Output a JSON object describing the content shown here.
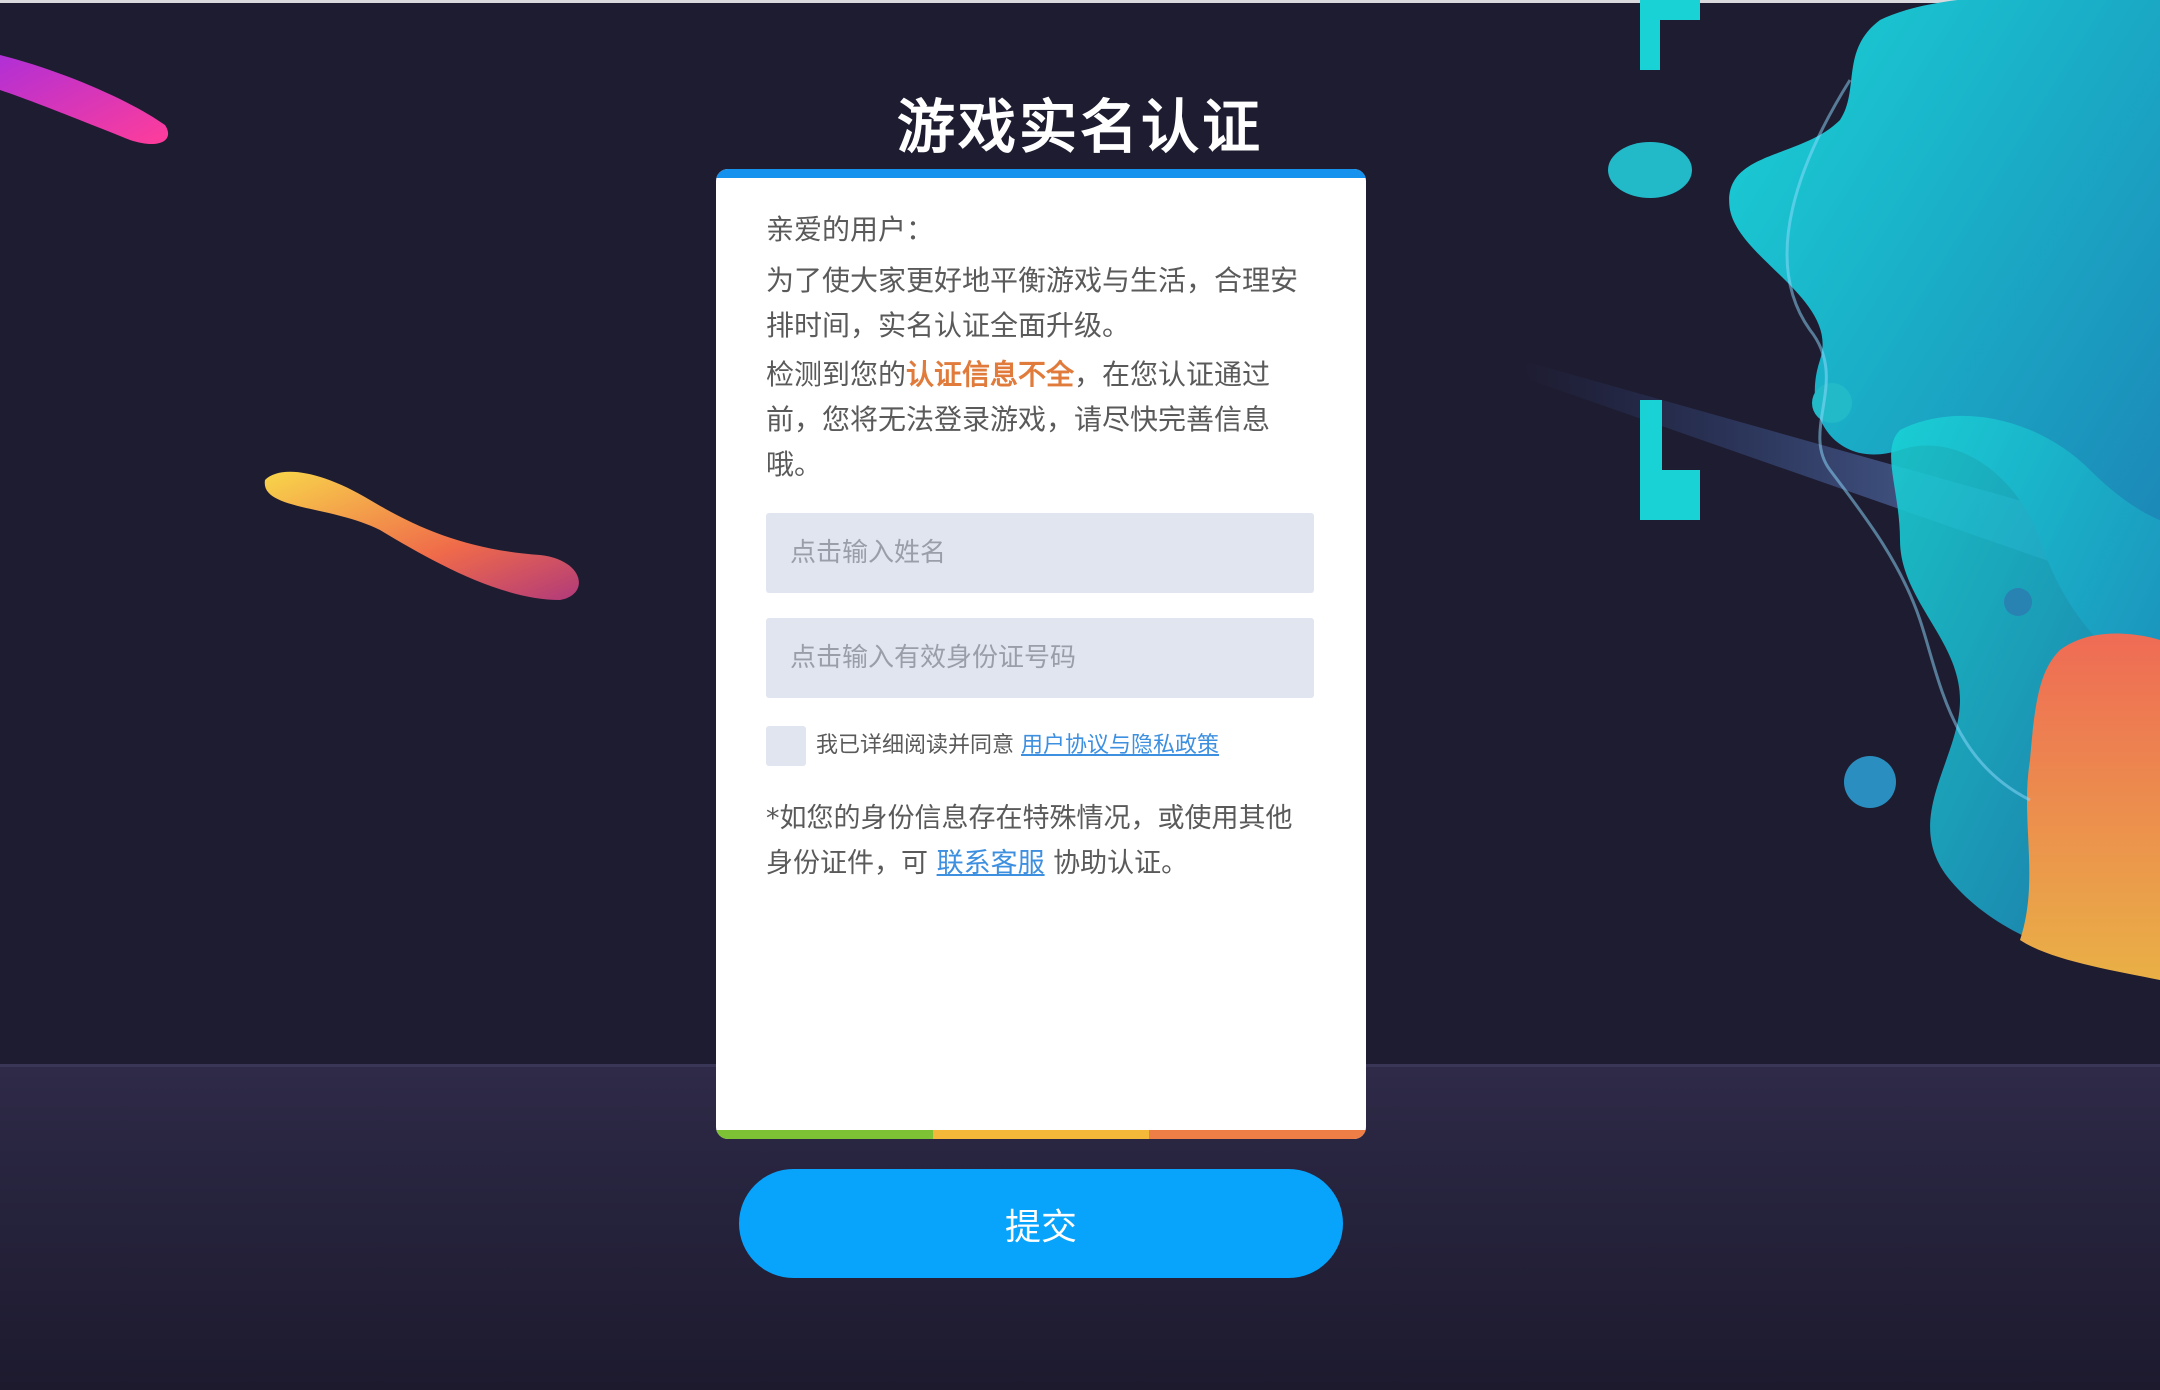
{
  "page": {
    "title": "游戏实名认证"
  },
  "card": {
    "greeting": "亲爱的用户：",
    "paragraph1": "为了使大家更好地平衡游戏与生活，合理安排时间，实名认证全面升级。",
    "paragraph2_before": "检测到您的",
    "paragraph2_highlight": "认证信息不全",
    "paragraph2_after": "，在您认证通过前，您将无法登录游戏，请尽快完善信息哦。",
    "name_input": {
      "placeholder": "点击输入姓名",
      "value": ""
    },
    "id_input": {
      "placeholder": "点击输入有效身份证号码",
      "value": ""
    },
    "agreement": {
      "checked": false,
      "text": "我已详细阅读并同意",
      "link": "用户协议与隐私政策"
    },
    "note": {
      "before": "*如您的身份信息存在特殊情况，或使用其他身份证件，可 ",
      "link": "联系客服",
      "after": " 协助认证。"
    }
  },
  "submit": {
    "label": "提交"
  },
  "colors": {
    "accent_blue": "#08a3fb",
    "card_top_bar": "#1592ee",
    "highlight": "#e07b3c",
    "link": "#3d8fe0",
    "bottom_bar": [
      "#7dc135",
      "#f5b93a",
      "#ee7e46"
    ]
  }
}
